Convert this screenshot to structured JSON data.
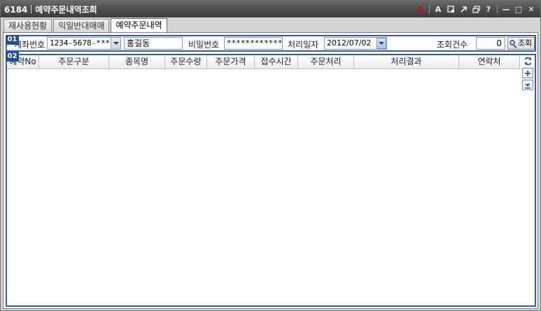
{
  "window": {
    "title_code": "6184",
    "title_name": "예약주문내역조회",
    "icons": [
      "play-icon",
      "font-icon",
      "screenshot-icon",
      "link-icon",
      "copy-window-icon",
      "help-icon",
      "minimize-icon",
      "maximize-icon",
      "close-icon"
    ],
    "title_icon_glyphs": {
      "font": "A",
      "help": "?",
      "minimize": "—",
      "maximize": "□",
      "close": "✕"
    }
  },
  "tabs": [
    {
      "label": "재사용현황",
      "active": false
    },
    {
      "label": "익일반대매매",
      "active": false
    },
    {
      "label": "예약주문내역",
      "active": true
    }
  ],
  "filter": {
    "section_badge": "01",
    "account_label": "계좌번호",
    "account_value": "1234-5678-****",
    "name_value": "홍길동",
    "password_label": "비밀번호",
    "password_value": "**************",
    "date_label": "처리일자",
    "date_value": "2012/07/02",
    "count_label": "조회건수",
    "count_value": "0",
    "search_label": "조회"
  },
  "grid": {
    "section_badge": "02",
    "columns": [
      "예약No",
      "주문구분",
      "종목명",
      "주문수량",
      "주문가격",
      "접수시간",
      "주문처리",
      "처리결과",
      "연락처"
    ],
    "rows": []
  },
  "colors": {
    "title_bar": "#4a4a4a",
    "section_border": "#2f5f9f",
    "badge": "#1f4f8f",
    "alert_arrow": "#e00000"
  }
}
